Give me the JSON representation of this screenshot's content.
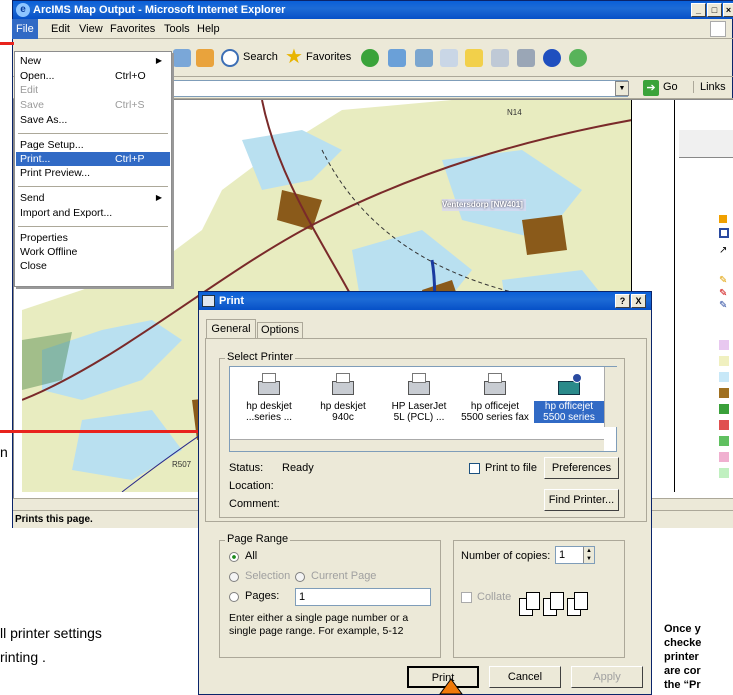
{
  "window": {
    "title": "ArcIMS Map Output - Microsoft Internet Explorer",
    "status_text": "Prints this page."
  },
  "menubar": {
    "file": "File",
    "edit": "Edit",
    "view": "View",
    "favorites": "Favorites",
    "tools": "Tools",
    "help": "Help"
  },
  "toolbar": {
    "search": "Search",
    "favorites": "Favorites"
  },
  "address": {
    "go": "Go",
    "links": "Links"
  },
  "file_menu": {
    "new": "New",
    "open": "Open...",
    "open_sc": "Ctrl+O",
    "edit": "Edit",
    "save": "Save",
    "save_sc": "Ctrl+S",
    "save_as": "Save As...",
    "page_setup": "Page Setup...",
    "print": "Print...",
    "print_sc": "Ctrl+P",
    "print_preview": "Print Preview...",
    "send": "Send",
    "import_export": "Import and Export...",
    "properties": "Properties",
    "work_offline": "Work Offline",
    "close": "Close"
  },
  "map": {
    "label_town": "Ventersdorp [NW401]",
    "road1": "N14",
    "road2": "R507"
  },
  "print_dialog": {
    "title": "Print",
    "help_btn": "?",
    "close_btn": "X",
    "tab_general": "General",
    "tab_options": "Options",
    "select_printer": "Select Printer",
    "printers": [
      {
        "l1": "hp deskjet",
        "l2": "...series ..."
      },
      {
        "l1": "hp deskjet",
        "l2": "940c"
      },
      {
        "l1": "HP LaserJet",
        "l2": "5L (PCL) ..."
      },
      {
        "l1": "hp officejet",
        "l2": "5500 series fax"
      },
      {
        "l1": "hp officejet",
        "l2": "5500 series"
      }
    ],
    "status_label": "Status:",
    "status_value": "Ready",
    "location_label": "Location:",
    "comment_label": "Comment:",
    "print_to_file": "Print to file",
    "preferences": "Preferences",
    "find_printer": "Find Printer...",
    "page_range": "Page Range",
    "all": "All",
    "selection": "Selection",
    "current_page": "Current Page",
    "pages": "Pages:",
    "pages_value": "1",
    "hint": "Enter either a single page number or a single page range.  For example, 5-12",
    "copies_label": "Number of copies:",
    "copies_value": "1",
    "collate": "Collate",
    "print": "Print",
    "cancel": "Cancel",
    "apply": "Apply"
  },
  "annotations": {
    "left_fragment_1": "ll printer settings",
    "left_fragment_2": "rinting .",
    "left_fragment_h": "n",
    "right_1": "Once y",
    "right_2": "checke",
    "right_3": "printer",
    "right_4": "are cor",
    "right_5": "the “Pr"
  },
  "colors": {
    "title_blue": "#0a5fd8",
    "arrow_red": "#e8231d",
    "arrow_orange": "#f07a0a",
    "selection_blue": "#316ac5"
  }
}
